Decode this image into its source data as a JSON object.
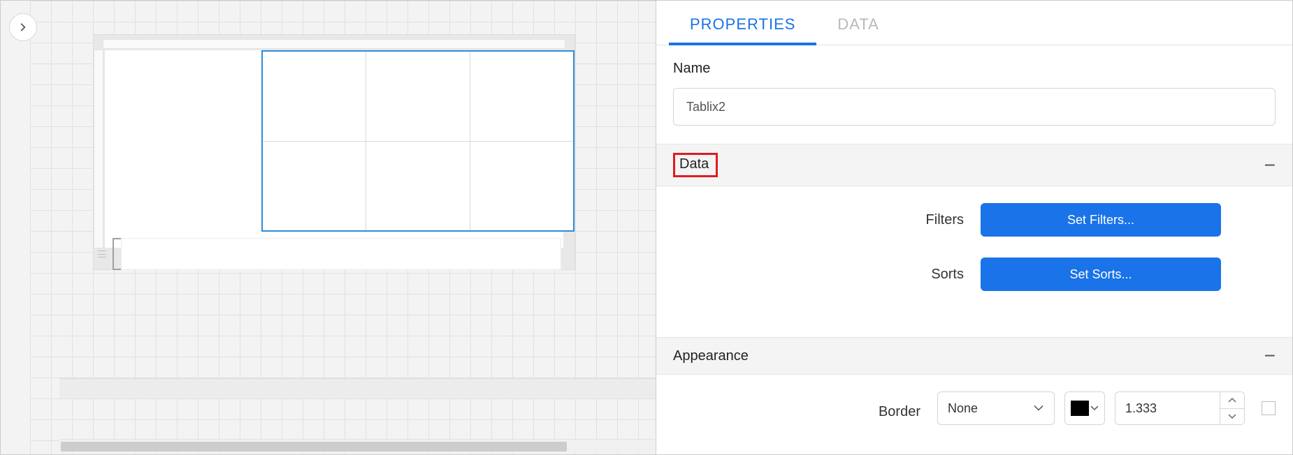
{
  "tabs": {
    "properties": "PROPERTIES",
    "data": "DATA"
  },
  "name_section": {
    "label": "Name",
    "value": "Tablix2"
  },
  "data_section": {
    "title": "Data",
    "filters_label": "Filters",
    "filters_button": "Set Filters...",
    "sorts_label": "Sorts",
    "sorts_button": "Set Sorts..."
  },
  "appearance_section": {
    "title": "Appearance",
    "border_label": "Border",
    "border_style": "None",
    "border_color": "#000000",
    "border_width": "1.333"
  }
}
